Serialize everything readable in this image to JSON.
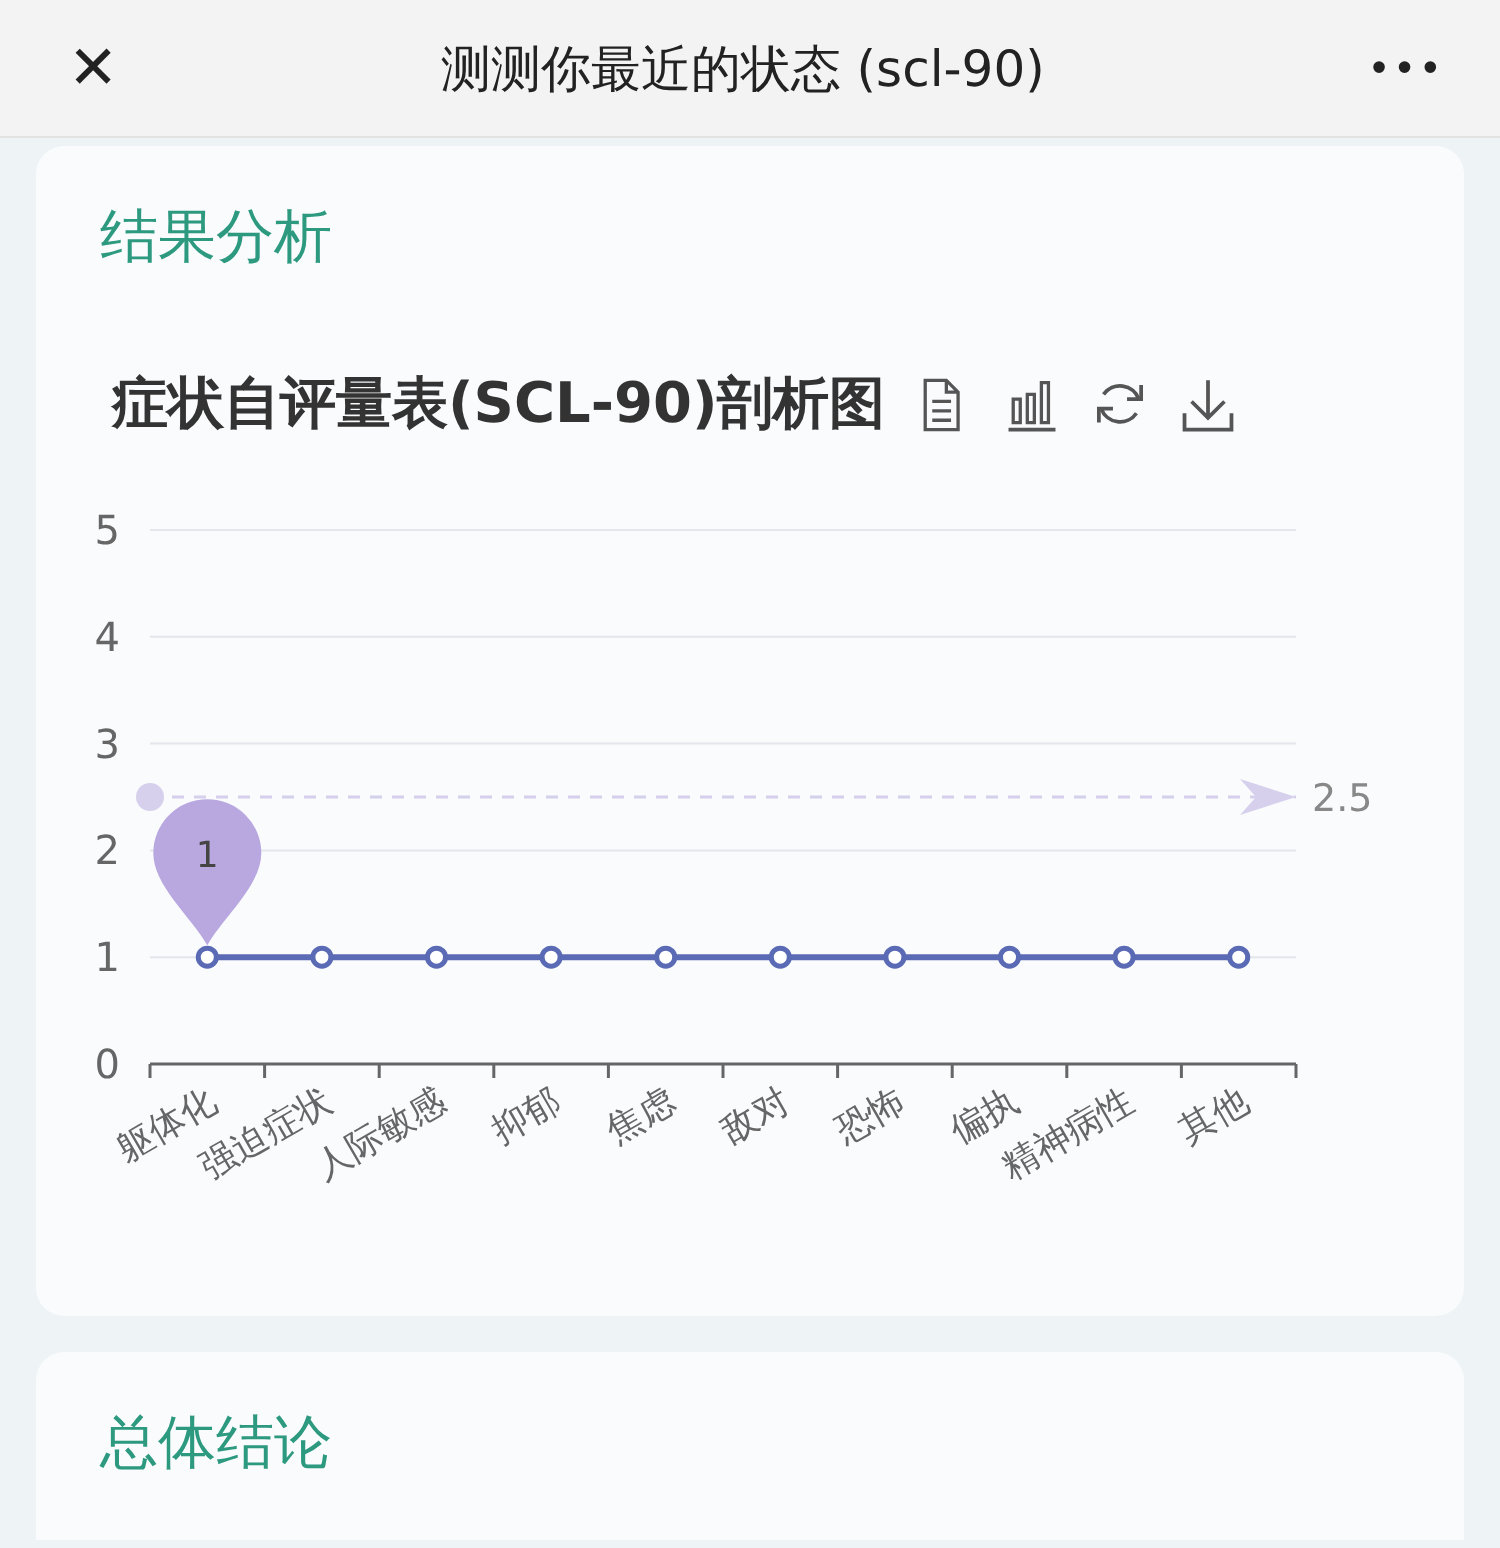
{
  "top_bar": {
    "close": "✕",
    "title": "测测你最近的状态 (scl-90)",
    "more": "•••"
  },
  "cards": [
    {
      "heading": "结果分析",
      "chart_title": "症状自评量表(SCL-90)剖析图",
      "chart_data": {
        "type": "line",
        "categories": [
          "躯体化",
          "强迫症状",
          "人际敏感",
          "抑郁",
          "焦虑",
          "敌对",
          "恐怖",
          "偏执",
          "精神病性",
          "其他"
        ],
        "series": [
          {
            "color": "#5b6ab4",
            "marker": "circle",
            "values": [
              1,
              1,
              1,
              1,
              1,
              1,
              1,
              1,
              1,
              1
            ]
          }
        ],
        "ylim": [
          0,
          5
        ],
        "yticks": [
          0,
          1,
          2,
          3,
          4,
          5
        ],
        "grid": true,
        "annotations": [
          {
            "text": "1",
            "x": "躯体化",
            "y": 1
          }
        ],
        "ref_lines": [
          {
            "axis": "y",
            "value": 2.5,
            "label": "2.5",
            "color": "#d6d0ec"
          }
        ]
      }
    },
    {
      "heading": "总体结论"
    }
  ]
}
